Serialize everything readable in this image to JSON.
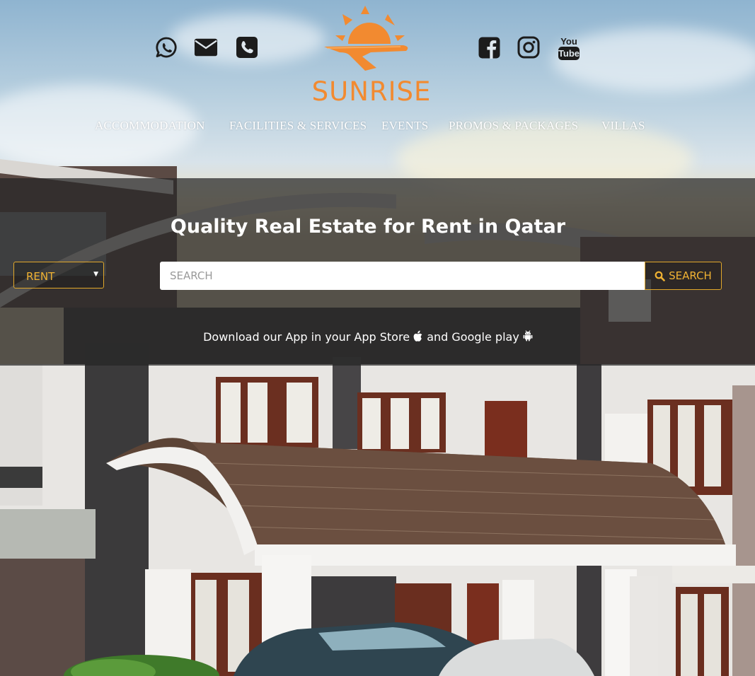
{
  "header": {
    "brand": "SUNRISE",
    "contact_icons": [
      "whatsapp-icon",
      "envelope-icon",
      "phone-icon"
    ],
    "social_icons": [
      "facebook-icon",
      "instagram-icon",
      "youtube-icon"
    ],
    "youtube_top": "You",
    "youtube_bottom": "Tube"
  },
  "nav": {
    "items": [
      {
        "label": "ACCOMMODATION"
      },
      {
        "label": "FACILITIES & SERVICES"
      },
      {
        "label": "EVENTS"
      },
      {
        "label": "PROMOS & PACKAGES"
      },
      {
        "label": "VILLAS"
      }
    ]
  },
  "search": {
    "headline": "Quality Real Estate for Rent in Qatar",
    "mode_value": "RENT",
    "placeholder": "SEARCH",
    "button_label": "SEARCH"
  },
  "download": {
    "text_before": "Download our App in your App Store",
    "text_middle": "and Google play"
  },
  "colors": {
    "accent": "#f28a30",
    "gold": "#f0b233",
    "band": "#262626"
  }
}
